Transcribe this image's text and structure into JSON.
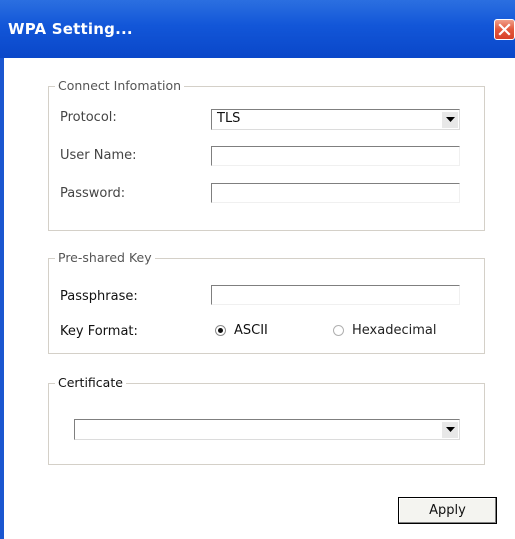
{
  "window": {
    "title": "WPA Setting...",
    "close_icon": "close-icon",
    "accent_color": "#1256d8",
    "close_color": "#e3573b"
  },
  "connect_info": {
    "legend": "Connect Infomation",
    "protocol_label": "Protocol:",
    "protocol_value": "TLS",
    "username_label": "User Name:",
    "username_value": "",
    "password_label": "Password:",
    "password_value": ""
  },
  "preshared_key": {
    "legend": "Pre-shared Key",
    "passphrase_label": "Passphrase:",
    "passphrase_value": "",
    "key_format_label": "Key Format:",
    "options": [
      {
        "label": "ASCII",
        "selected": true
      },
      {
        "label": "Hexadecimal",
        "selected": false
      }
    ]
  },
  "certificate": {
    "legend": "Certificate",
    "selected_value": ""
  },
  "actions": {
    "apply_label": "Apply"
  }
}
